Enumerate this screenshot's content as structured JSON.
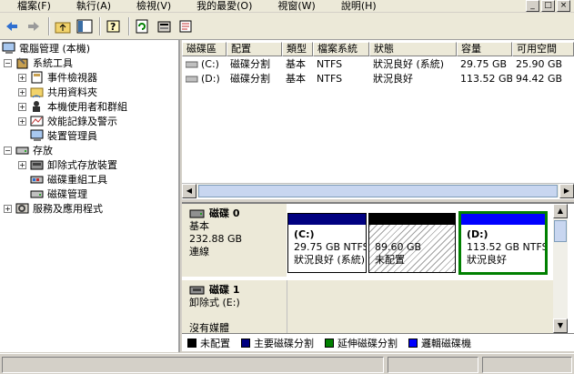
{
  "menu": [
    "檔案(F)",
    "執行(A)",
    "檢視(V)",
    "我的最愛(O)",
    "視窗(W)",
    "說明(H)"
  ],
  "window_buttons": [
    "_",
    "□",
    "×"
  ],
  "toolbar_icons": [
    "back-arrow-icon",
    "forward-arrow-icon",
    "up-folder-icon",
    "show-hide-tree-icon",
    "help-icon",
    "refresh-icon",
    "properties-icon",
    "export-list-icon"
  ],
  "tree": {
    "root": "電腦管理 (本機)",
    "system_tools": "系統工具",
    "event_viewer": "事件檢視器",
    "shared_folders": "共用資料夾",
    "local_users": "本機使用者和群組",
    "perf_logs": "效能記錄及警示",
    "device_manager": "裝置管理員",
    "storage": "存放",
    "removable_storage": "卸除式存放裝置",
    "defrag": "磁碟重組工具",
    "disk_management": "磁碟管理",
    "services_apps": "服務及應用程式"
  },
  "list": {
    "columns": [
      "磁碟區",
      "配置",
      "類型",
      "檔案系統",
      "狀態",
      "容量",
      "可用空間"
    ],
    "rows": [
      [
        "(C:)",
        "磁碟分割",
        "基本",
        "NTFS",
        "狀況良好 (系統)",
        "29.75 GB",
        "25.90 GB"
      ],
      [
        "(D:)",
        "磁碟分割",
        "基本",
        "NTFS",
        "狀況良好",
        "113.52 GB",
        "94.42 GB"
      ]
    ]
  },
  "disk0": {
    "title": "磁碟 0",
    "type": "基本",
    "size": "232.88 GB",
    "status": "連線",
    "partitions": [
      {
        "name": "(C:)",
        "size": "29.75 GB NTFS",
        "status": "狀況良好 (系統)"
      },
      {
        "name": "",
        "size": "89.60 GB",
        "status": "未配置"
      },
      {
        "name": "(D:)",
        "size": "113.52 GB NTFS",
        "status": "狀況良好"
      }
    ]
  },
  "disk1": {
    "title": "磁碟 1",
    "type": "卸除式 (E:)",
    "status": "沒有媒體"
  },
  "legend": [
    {
      "label": "未配置",
      "color": "#000000"
    },
    {
      "label": "主要磁碟分割",
      "color": "#000080"
    },
    {
      "label": "延伸磁碟分割",
      "color": "#008000"
    },
    {
      "label": "邏輯磁碟機",
      "color": "#0000ff"
    }
  ],
  "colors": {
    "primary": "#000080",
    "unallocated": "#000000",
    "extended": "#008000",
    "logical": "#0000ff"
  }
}
